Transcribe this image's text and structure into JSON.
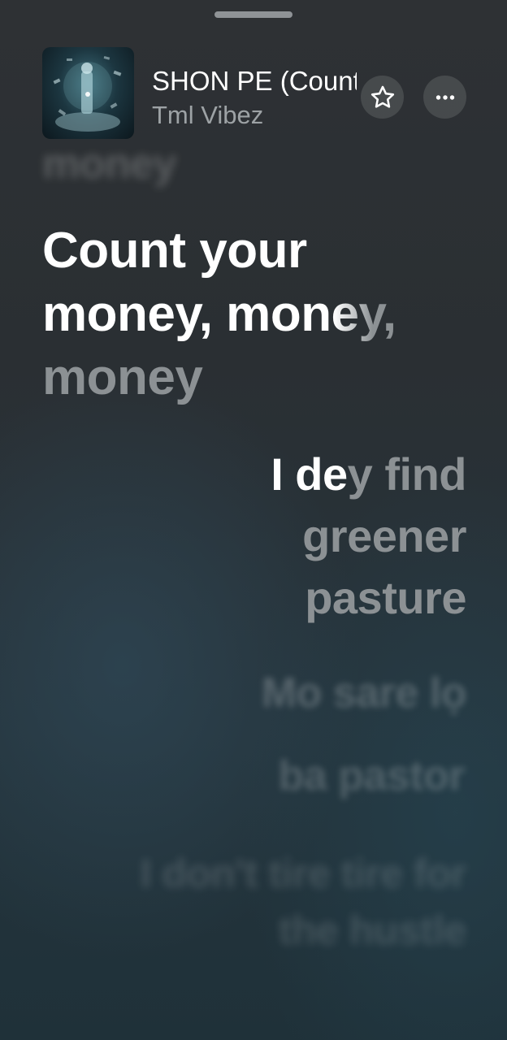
{
  "track": {
    "title": "SHON PE (Count Your Money)",
    "artist": "Tml Vibez"
  },
  "icons": {
    "favorite": "star-icon",
    "more": "more-horizontal-icon",
    "handle": "sheet-grabber"
  },
  "lyrics": {
    "previous": "money",
    "current": {
      "sung": "Count your money, mo",
      "unsung_partial": "ney,",
      "unsung_rest": "money"
    },
    "next": {
      "sung": "I de",
      "partial": "y",
      "rest": "find greener pasture"
    },
    "upcoming": [
      "Mo sare lọ",
      "ba pastor",
      "I don't tire tire for the hustle"
    ]
  },
  "colors": {
    "active_text": "#ffffff",
    "inactive_text": "#8c9194",
    "artist_text": "#9da2a5"
  }
}
